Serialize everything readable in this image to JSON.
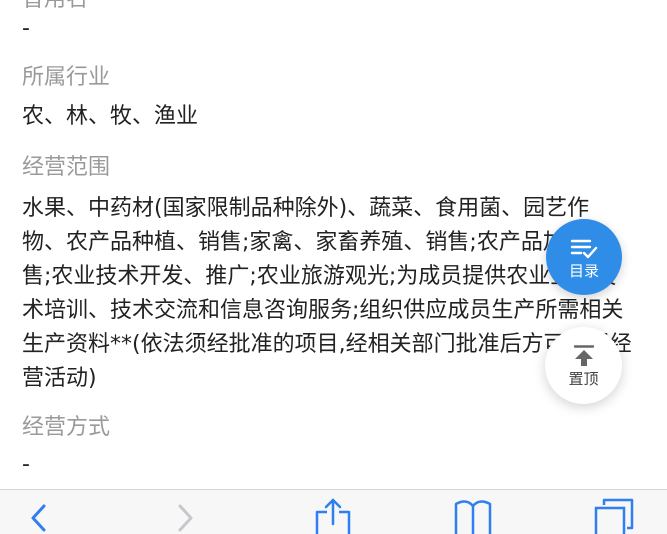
{
  "previous_section": {
    "label_partial": "曾用名",
    "value": "-"
  },
  "industry": {
    "label": "所属行业",
    "value": "农、林、牧、渔业"
  },
  "business_scope": {
    "label": "经营范围",
    "value": "水果、中药材(国家限制品种除外)、蔬菜、食用菌、园艺作物、农产品种植、销售;家禽、家畜养殖、销售;农产品加工销售;农业技术开发、推广;农业旅游观光;为成员提供农业生产技术培训、技术交流和信息咨询服务;组织供应成员生产所需相关生产资料**(依法须经批准的项目,经相关部门批准后方可开展经营活动)"
  },
  "business_mode": {
    "label": "经营方式",
    "value": "-"
  },
  "fab": {
    "catalog_label": "目录",
    "top_label": "置顶",
    "accent": "#2f8de8"
  },
  "toolbar": {
    "icons": [
      "back-arrow-icon",
      "forward-arrow-icon",
      "share-icon",
      "bookmarks-icon",
      "tabs-icon"
    ]
  }
}
